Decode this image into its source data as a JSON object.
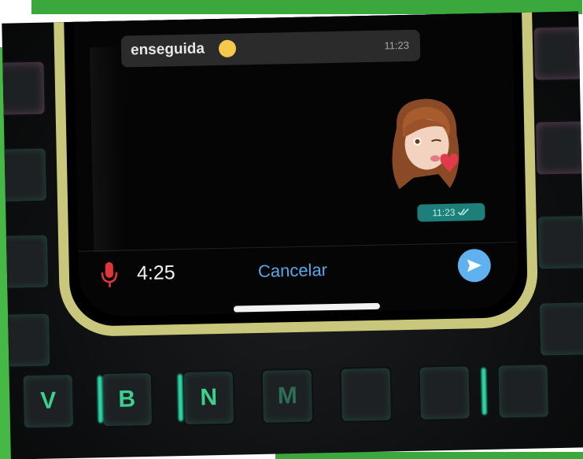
{
  "chat": {
    "incoming": {
      "text": "enseguida",
      "emoji": "sleepy-face-emoji",
      "time": "11:23"
    },
    "sticker": {
      "name": "memoji-kiss-heart-sticker",
      "time": "11:23"
    }
  },
  "recorder": {
    "duration": "4:25",
    "cancel_label": "Cancelar",
    "mic_icon": "microphone-icon",
    "send_icon": "send-arrow-icon"
  },
  "keyboard": {
    "keys": [
      "V",
      "B",
      "N",
      "M"
    ]
  },
  "colors": {
    "frame_green": "#3aa83c",
    "phone_case": "#c9c77c",
    "cancel_blue": "#5aa7e8",
    "send_blue": "#5fb2ef",
    "mic_red": "#e0353b",
    "time_pill": "#1e7f7a",
    "key_glow": "#3ccf8e"
  }
}
